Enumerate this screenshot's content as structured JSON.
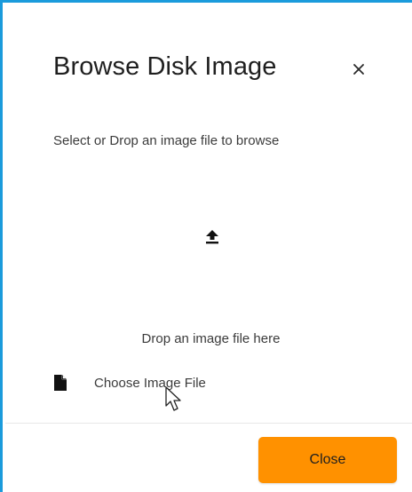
{
  "dialog": {
    "title": "Browse Disk Image",
    "close_icon": "close-icon",
    "subtitle": "Select or Drop an image file to browse",
    "dropzone": {
      "upload_icon": "upload-icon",
      "text": "Drop an image file here"
    },
    "choose_file": {
      "icon": "file-icon",
      "label": "Choose Image File"
    },
    "footer": {
      "close_label": "Close"
    }
  },
  "colors": {
    "accent_border": "#1a9bdc",
    "button_orange": "#ff9100",
    "text": "#1f1f1f"
  }
}
